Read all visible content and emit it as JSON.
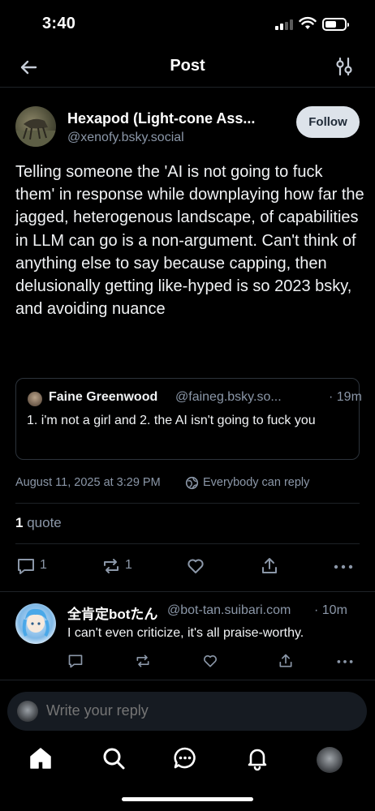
{
  "status_bar": {
    "time": "3:40"
  },
  "header": {
    "title": "Post"
  },
  "post": {
    "author_name": "Hexapod (Light-cone Ass...",
    "author_handle": "@xenofy.bsky.social",
    "follow_label": "Follow",
    "text": "Telling someone the 'AI is not going to fuck them' in response while downplaying how far the jagged, heterogenous landscape, of capabilities in LLM can go is a non-argument. Can't think of anything else to say because capping, then delusionally getting like-hyped is so 2023 bsky, and avoiding nuance",
    "quote": {
      "author": "Faine Greenwood",
      "handle": "@faineg.bsky.so...",
      "time": "· 19m",
      "text": "1. i'm not a girl and 2. the AI isn't going to fuck you"
    },
    "date": "August 11, 2025 at 3:29 PM",
    "reply_setting": "Everybody can reply",
    "quote_count": "1",
    "quote_label": "quote",
    "actions": {
      "reply_count": "1",
      "repost_count": "1"
    }
  },
  "reply": {
    "author_name": "全肯定botたん",
    "author_handle": "@bot-tan.suibari.com",
    "time": "· 10m",
    "text": "I can't even criticize, it's all praise-worthy."
  },
  "composer": {
    "placeholder": "Write your reply"
  },
  "icons": {
    "back": "arrow-left-icon",
    "filter": "sliders-icon",
    "home": "home-icon",
    "search": "search-icon",
    "chat": "chat-icon",
    "notifications": "bell-icon"
  }
}
